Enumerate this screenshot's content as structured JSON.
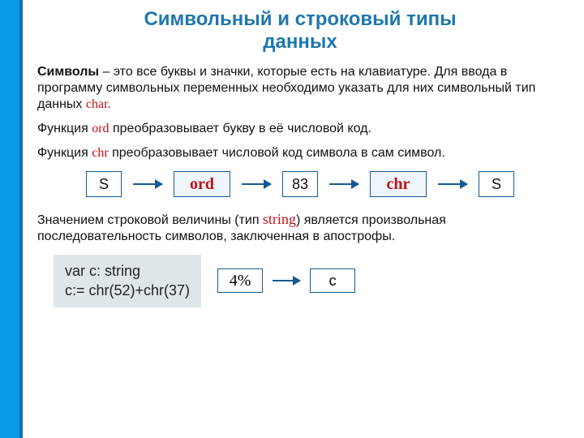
{
  "title_line1": "Символьный и строковый типы",
  "title_line2": "данных",
  "para1_lead": "Символы",
  "para1_rest": " – это все буквы и значки, которые есть на клавиатуре. Для ввода в программу символьных переменных необходимо указать для них символьный тип данных ",
  "kw_char": "char.",
  "para2_pre": "Функция ",
  "kw_ord": "ord",
  "para2_post": " преобразовывает букву в её числовой код.",
  "para3_pre": "Функция ",
  "kw_chr": "chr",
  "para3_post": " преобразовывает числовой код символа в сам символ.",
  "flow": {
    "n1": "S",
    "fn1": "ord",
    "n2": "83",
    "fn2": "chr",
    "n3": "S"
  },
  "para4_pre": "Значением строковой величины (тип ",
  "kw_string": "string",
  "para4_post": ") является произвольная последовательность символов, заключенная в апострофы.",
  "code_line1": "var c: string",
  "code_line2": "c:= chr(52)+chr(37)",
  "flow2": {
    "n1": "4%",
    "n2": "c"
  }
}
